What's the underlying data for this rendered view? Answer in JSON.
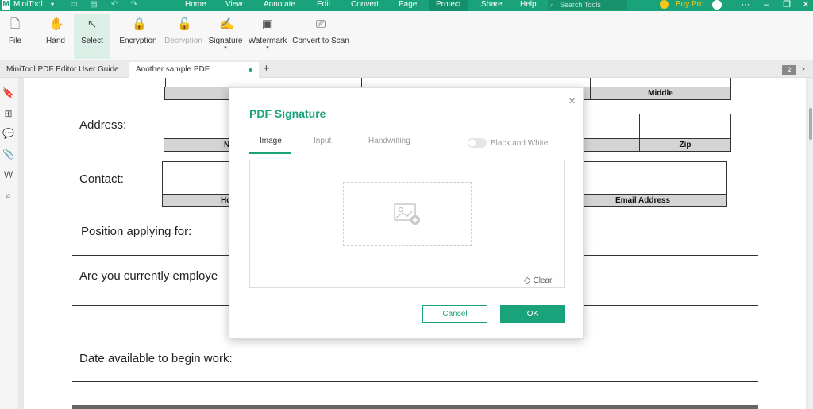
{
  "app": {
    "name": "MiniTool",
    "menu": [
      "Home",
      "View",
      "Annotate",
      "Edit",
      "Convert",
      "Page",
      "Protect",
      "Share",
      "Help"
    ],
    "active_menu": "Protect",
    "search_placeholder": "Search Tools",
    "buy_pro": "Buy Pro",
    "accent_color": "#1aa37a"
  },
  "ribbon": {
    "tools": [
      {
        "label": "File",
        "icon": "file-icon"
      },
      {
        "label": "Hand",
        "icon": "hand-icon"
      },
      {
        "label": "Select",
        "icon": "cursor-icon"
      },
      {
        "label": "Encryption",
        "icon": "lock-icon"
      },
      {
        "label": "Decryption",
        "icon": "unlock-icon"
      },
      {
        "label": "Signature",
        "icon": "signature-icon"
      },
      {
        "label": "Watermark",
        "icon": "watermark-icon"
      },
      {
        "label": "Convert to Scan",
        "icon": "scan-icon"
      }
    ]
  },
  "tabs": [
    {
      "label": "MiniTool PDF Editor User Guide"
    },
    {
      "label": "Another sample PDF"
    }
  ],
  "page_badge": "2",
  "document": {
    "middle": "Middle",
    "address": "Address:",
    "address_n": "N",
    "zip": "Zip",
    "contact": "Contact:",
    "contact_ho": "Ho",
    "email": "Email Address",
    "position": "Position applying for:",
    "employed": "Are you currently employe",
    "date_available": "Date available to begin work:"
  },
  "dialog": {
    "title": "PDF Signature",
    "tabs": [
      "Image",
      "Input",
      "Handwriting"
    ],
    "active_tab": "Image",
    "bw_label": "Black and White",
    "clear": "Clear",
    "cancel": "Cancel",
    "ok": "OK"
  }
}
